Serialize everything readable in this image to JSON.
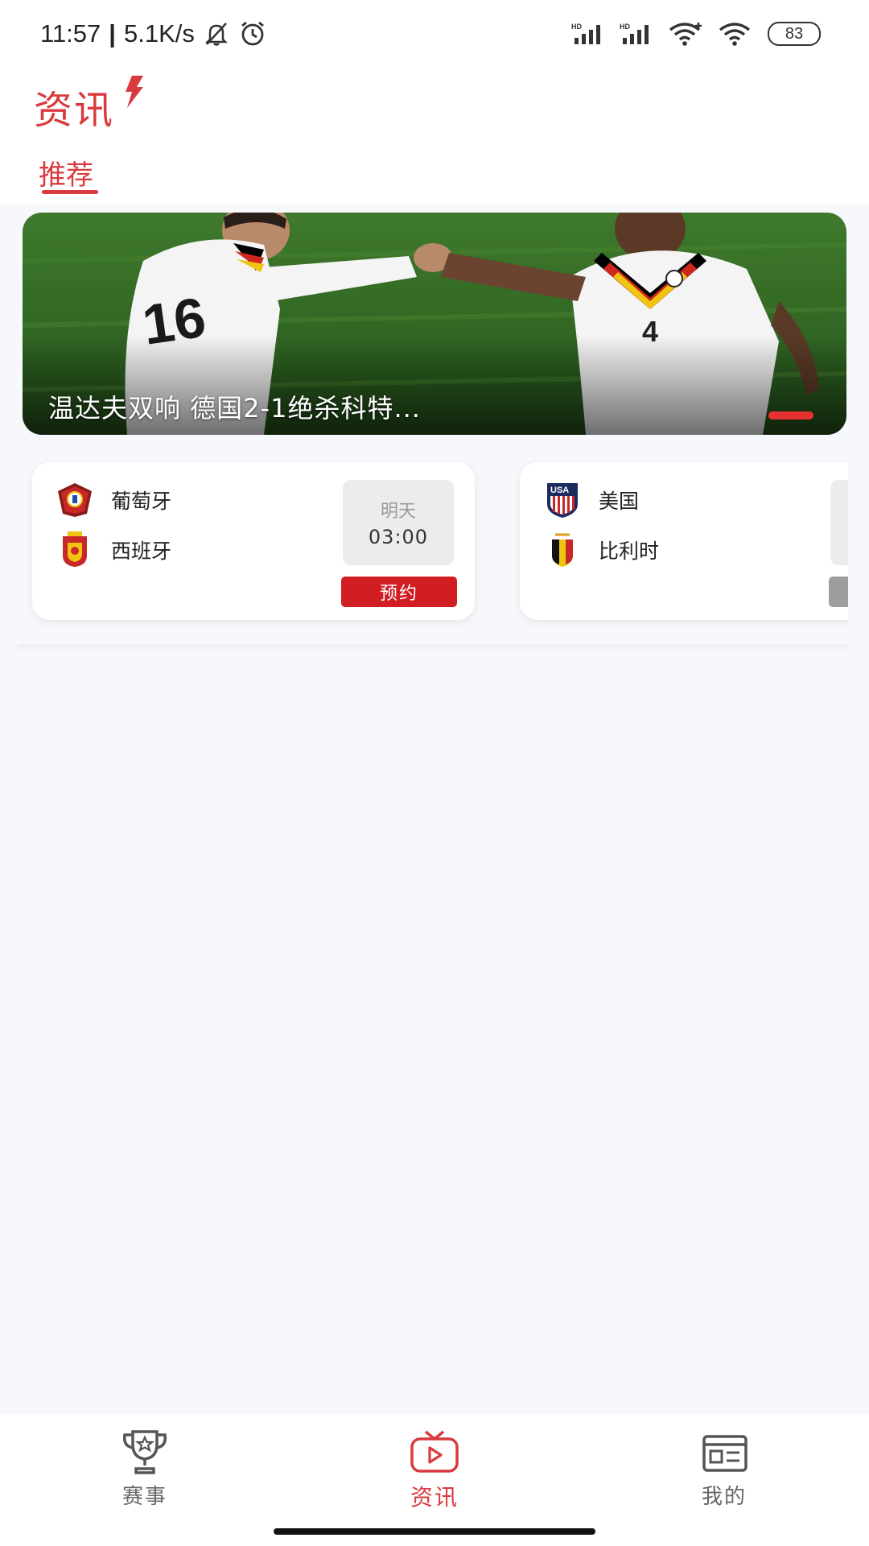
{
  "status_bar": {
    "time": "11:57",
    "speed": "5.1K/s",
    "battery": "83"
  },
  "header": {
    "title": "资讯",
    "tabs": [
      {
        "label": "推荐",
        "active": true
      }
    ]
  },
  "banner": {
    "caption": "温达夫双响 德国2-1绝杀科特...",
    "active_slide_color": "#e5312f"
  },
  "matches": [
    {
      "home": {
        "name": "葡萄牙",
        "flag": "portugal-crest-icon"
      },
      "away": {
        "name": "西班牙",
        "flag": "spain-crest-icon"
      },
      "day": "明天",
      "time": "03:00",
      "action": "预约"
    },
    {
      "home": {
        "name": "美国",
        "flag": "usa-crest-icon"
      },
      "away": {
        "name": "比利时",
        "flag": "belgium-crest-icon"
      }
    }
  ],
  "bottom_nav": {
    "items": [
      {
        "label": "赛事",
        "icon": "trophy-icon",
        "active": false
      },
      {
        "label": "资讯",
        "icon": "tv-play-icon",
        "active": true
      },
      {
        "label": "我的",
        "icon": "news-card-icon",
        "active": false
      }
    ]
  },
  "colors": {
    "accent": "#d93a3f",
    "reserve_button": "#d11e22",
    "background": "#f7f8fc"
  }
}
